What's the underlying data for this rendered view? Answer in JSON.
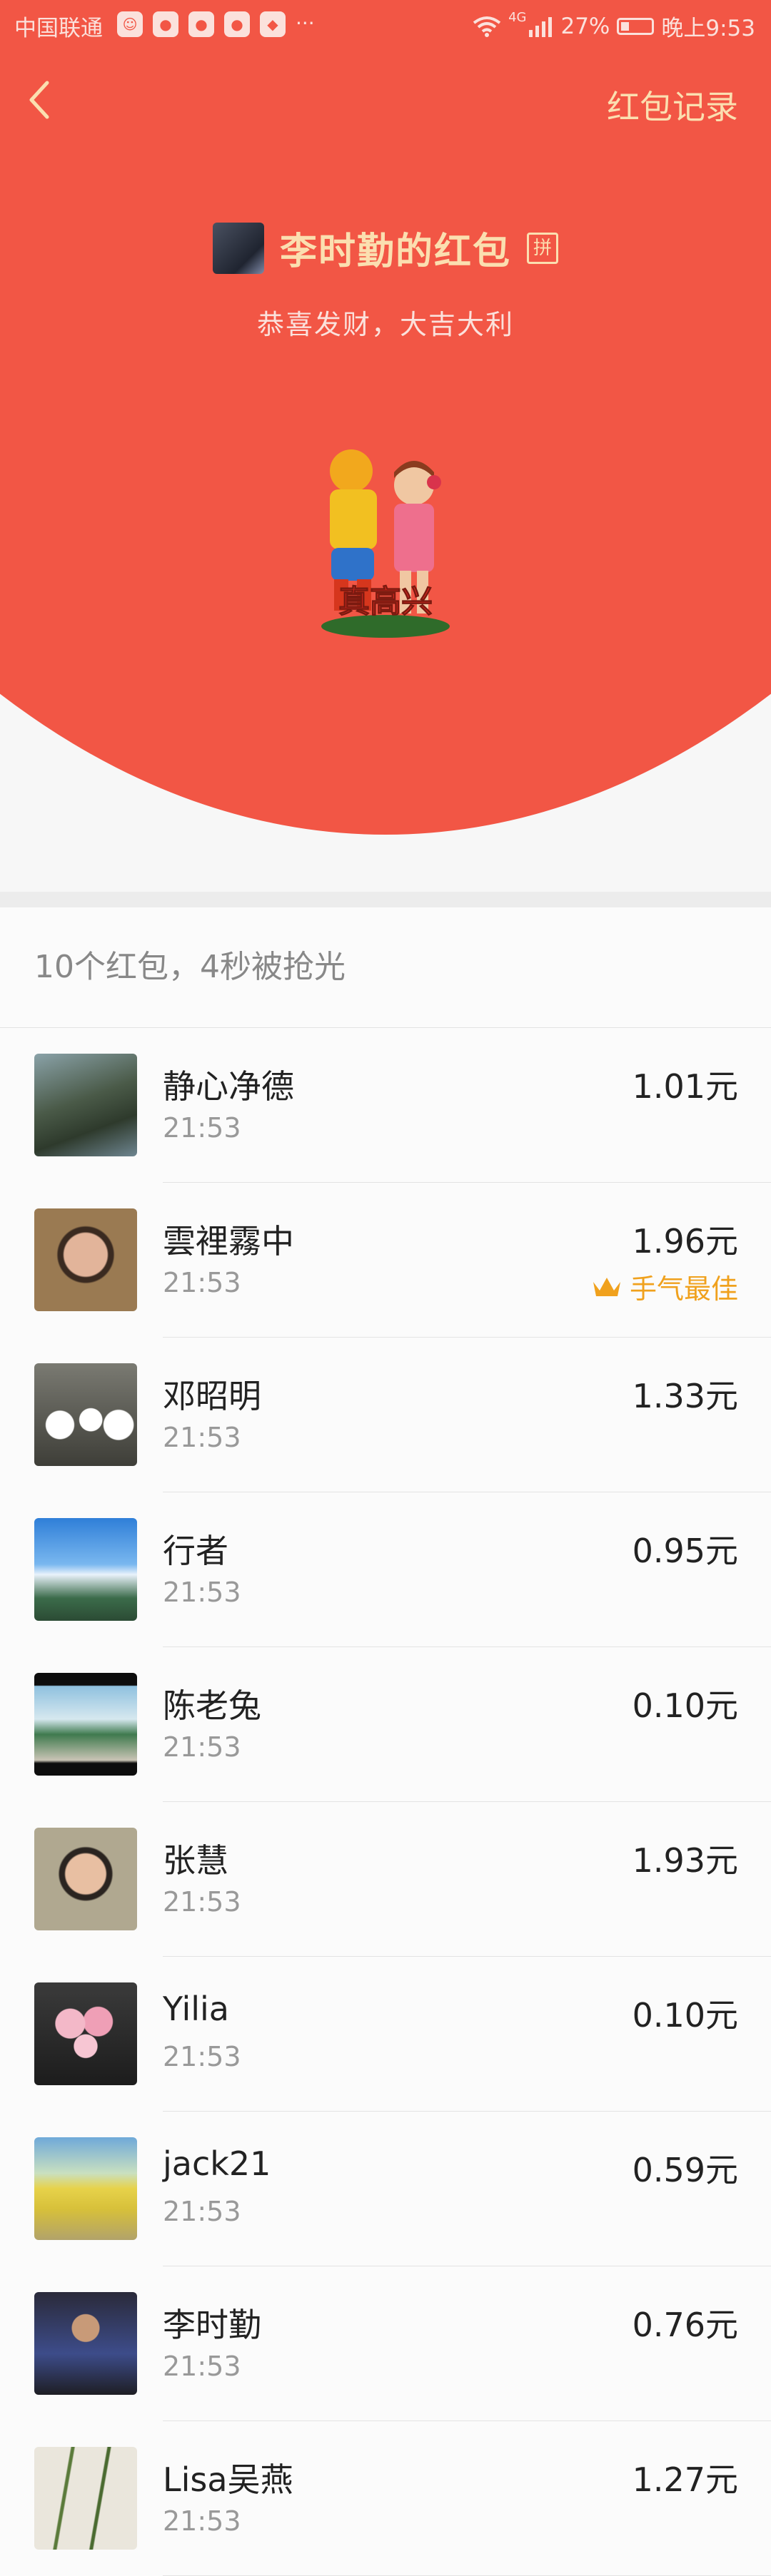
{
  "status_bar": {
    "carrier": "中国联通",
    "notif_icons": [
      "avatar-notification-icon",
      "app-notification-icon",
      "app-notification-icon",
      "app-notification-icon",
      "app-notification-icon"
    ],
    "more": "···",
    "network": "4G",
    "battery": "27%",
    "battery_level": 0.27,
    "time": "晚上9:53"
  },
  "header": {
    "records_label": "红包记录",
    "sender_name": "李时勤的红包",
    "pin_label": "拼",
    "greeting": "恭喜发财，大吉大利",
    "sticker_text": "真高兴"
  },
  "list": {
    "summary": "10个红包，4秒被抢光",
    "items": [
      {
        "name": "静心净德",
        "time": "21:53",
        "amount": "1.01元",
        "best": ""
      },
      {
        "name": "雲裡霧中",
        "time": "21:53",
        "amount": "1.96元",
        "best": "手气最佳"
      },
      {
        "name": "邓昭明",
        "time": "21:53",
        "amount": "1.33元",
        "best": ""
      },
      {
        "name": "行者",
        "time": "21:53",
        "amount": "0.95元",
        "best": ""
      },
      {
        "name": "陈老兔",
        "time": "21:53",
        "amount": "0.10元",
        "best": ""
      },
      {
        "name": "张慧",
        "time": "21:53",
        "amount": "1.93元",
        "best": ""
      },
      {
        "name": "Yilia",
        "time": "21:53",
        "amount": "0.10元",
        "best": ""
      },
      {
        "name": "jack21",
        "time": "21:53",
        "amount": "0.59元",
        "best": ""
      },
      {
        "name": "李时勤",
        "time": "21:53",
        "amount": "0.76元",
        "best": ""
      },
      {
        "name": "Lisa吴燕",
        "time": "21:53",
        "amount": "1.27元",
        "best": ""
      }
    ]
  },
  "colors": {
    "header_red": "#f25645",
    "gold_text": "#fbdfb0",
    "best_luck": "#f0a11d"
  }
}
